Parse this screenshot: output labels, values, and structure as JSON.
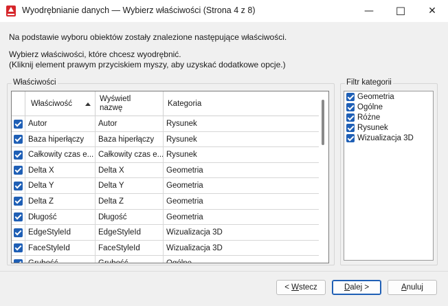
{
  "window": {
    "title": "Wyodrębnianie danych — Wybierz właściwości (Strona 4 z 8)",
    "minimize": "—",
    "maximize": "☐",
    "close": "✕"
  },
  "intro": {
    "line1": "Na podstawie wyboru obiektów zostały znalezione następujące właściwości.",
    "line2": "Wybierz właściwości, które chcesz wyodrębnić.",
    "line3": "(Kliknij element prawym przyciskiem myszy, aby uzyskać dodatkowe opcje.)"
  },
  "properties": {
    "group_label": "Właściwości",
    "columns": {
      "property": "Właściwość",
      "display_line1": "Wyświetl",
      "display_line2": "nazwę",
      "category": "Kategoria"
    },
    "rows": [
      {
        "property": "Autor",
        "display": "Autor",
        "category": "Rysunek",
        "checked": true
      },
      {
        "property": "Baza hiperłączy",
        "display": "Baza hiperłączy",
        "category": "Rysunek",
        "checked": true
      },
      {
        "property": "Całkowity czas e...",
        "display": "Całkowity czas e...",
        "category": "Rysunek",
        "checked": true
      },
      {
        "property": "Delta X",
        "display": "Delta X",
        "category": "Geometria",
        "checked": true
      },
      {
        "property": "Delta Y",
        "display": "Delta Y",
        "category": "Geometria",
        "checked": true
      },
      {
        "property": "Delta Z",
        "display": "Delta Z",
        "category": "Geometria",
        "checked": true
      },
      {
        "property": "Długość",
        "display": "Długość",
        "category": "Geometria",
        "checked": true
      },
      {
        "property": "EdgeStyleId",
        "display": "EdgeStyleId",
        "category": "Wizualizacja 3D",
        "checked": true
      },
      {
        "property": "FaceStyleId",
        "display": "FaceStyleId",
        "category": "Wizualizacja 3D",
        "checked": true
      },
      {
        "property": "Grubość",
        "display": "Grubość",
        "category": "Ogólne",
        "checked": true
      }
    ]
  },
  "filter": {
    "group_label": "Filtr kategorii",
    "items": [
      {
        "label": "Geometria",
        "checked": true
      },
      {
        "label": "Ogólne",
        "checked": true
      },
      {
        "label": "Różne",
        "checked": true
      },
      {
        "label": "Rysunek",
        "checked": true
      },
      {
        "label": "Wizualizacja 3D",
        "checked": true
      }
    ]
  },
  "buttons": {
    "back_prefix": "< ",
    "back_mnemonic": "W",
    "back_rest": "stecz",
    "next_mnemonic": "D",
    "next_rest": "alej >",
    "cancel_mnemonic": "A",
    "cancel_rest": "nuluj"
  },
  "colors": {
    "checkbox": "#1f5fb5",
    "accent": "#1f5fb5",
    "app_icon": "#d6262b"
  }
}
